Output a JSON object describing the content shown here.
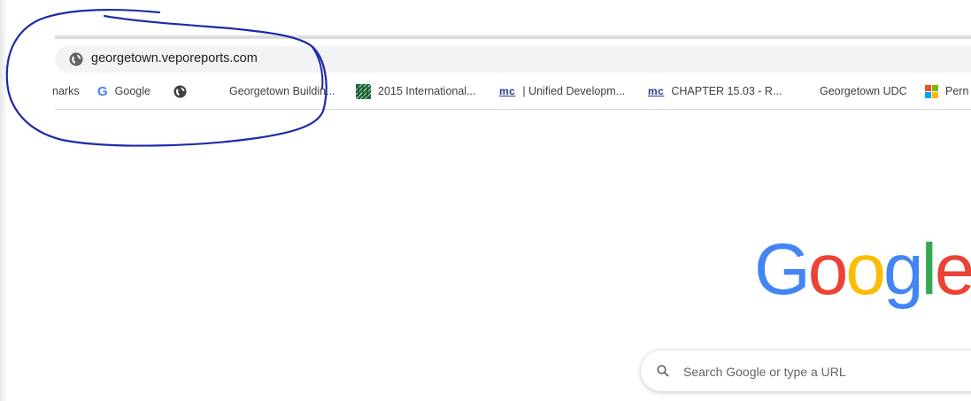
{
  "omnibox": {
    "url": "georgetown.veporeports.com",
    "site_icon": "globe-icon"
  },
  "bookmarks": [
    {
      "label": "narks",
      "icon": null
    },
    {
      "label": "Google",
      "icon": "google-g-icon"
    },
    {
      "label": "",
      "icon": "globe-icon"
    },
    {
      "label": "Georgetown Buildin...",
      "icon": null
    },
    {
      "label": "2015 International...",
      "icon": "building-codes-icon"
    },
    {
      "label": "| Unified Developm...",
      "icon": "mc-icon"
    },
    {
      "label": "CHAPTER 15.03 - R...",
      "icon": "mc-icon"
    },
    {
      "label": "Georgetown UDC",
      "icon": null
    },
    {
      "label": "Pern",
      "icon": "microsoft-icon"
    }
  ],
  "icon_text": {
    "google_g": "G",
    "mc": "mc"
  },
  "new_tab": {
    "logo_letters": [
      "G",
      "o",
      "o",
      "g",
      "l",
      "e"
    ],
    "logo_colors": [
      "#4285f4",
      "#ea4335",
      "#fbbc05",
      "#4285f4",
      "#34a853",
      "#ea4335"
    ],
    "search_placeholder": "Search Google or type a URL"
  },
  "annotation": {
    "color": "#1f2aa8",
    "shape": "hand-drawn-circle"
  }
}
